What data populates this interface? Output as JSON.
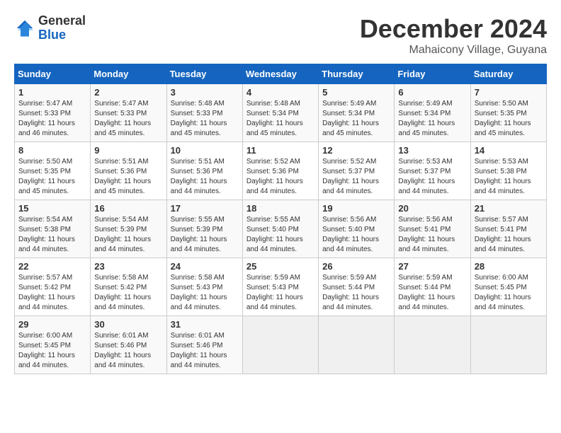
{
  "header": {
    "logo_line1": "General",
    "logo_line2": "Blue",
    "month": "December 2024",
    "location": "Mahaicony Village, Guyana"
  },
  "weekdays": [
    "Sunday",
    "Monday",
    "Tuesday",
    "Wednesday",
    "Thursday",
    "Friday",
    "Saturday"
  ],
  "weeks": [
    [
      {
        "day": "1",
        "sunrise": "5:47 AM",
        "sunset": "5:33 PM",
        "daylight": "11 hours and 46 minutes."
      },
      {
        "day": "2",
        "sunrise": "5:47 AM",
        "sunset": "5:33 PM",
        "daylight": "11 hours and 45 minutes."
      },
      {
        "day": "3",
        "sunrise": "5:48 AM",
        "sunset": "5:33 PM",
        "daylight": "11 hours and 45 minutes."
      },
      {
        "day": "4",
        "sunrise": "5:48 AM",
        "sunset": "5:34 PM",
        "daylight": "11 hours and 45 minutes."
      },
      {
        "day": "5",
        "sunrise": "5:49 AM",
        "sunset": "5:34 PM",
        "daylight": "11 hours and 45 minutes."
      },
      {
        "day": "6",
        "sunrise": "5:49 AM",
        "sunset": "5:34 PM",
        "daylight": "11 hours and 45 minutes."
      },
      {
        "day": "7",
        "sunrise": "5:50 AM",
        "sunset": "5:35 PM",
        "daylight": "11 hours and 45 minutes."
      }
    ],
    [
      {
        "day": "8",
        "sunrise": "5:50 AM",
        "sunset": "5:35 PM",
        "daylight": "11 hours and 45 minutes."
      },
      {
        "day": "9",
        "sunrise": "5:51 AM",
        "sunset": "5:36 PM",
        "daylight": "11 hours and 45 minutes."
      },
      {
        "day": "10",
        "sunrise": "5:51 AM",
        "sunset": "5:36 PM",
        "daylight": "11 hours and 44 minutes."
      },
      {
        "day": "11",
        "sunrise": "5:52 AM",
        "sunset": "5:36 PM",
        "daylight": "11 hours and 44 minutes."
      },
      {
        "day": "12",
        "sunrise": "5:52 AM",
        "sunset": "5:37 PM",
        "daylight": "11 hours and 44 minutes."
      },
      {
        "day": "13",
        "sunrise": "5:53 AM",
        "sunset": "5:37 PM",
        "daylight": "11 hours and 44 minutes."
      },
      {
        "day": "14",
        "sunrise": "5:53 AM",
        "sunset": "5:38 PM",
        "daylight": "11 hours and 44 minutes."
      }
    ],
    [
      {
        "day": "15",
        "sunrise": "5:54 AM",
        "sunset": "5:38 PM",
        "daylight": "11 hours and 44 minutes."
      },
      {
        "day": "16",
        "sunrise": "5:54 AM",
        "sunset": "5:39 PM",
        "daylight": "11 hours and 44 minutes."
      },
      {
        "day": "17",
        "sunrise": "5:55 AM",
        "sunset": "5:39 PM",
        "daylight": "11 hours and 44 minutes."
      },
      {
        "day": "18",
        "sunrise": "5:55 AM",
        "sunset": "5:40 PM",
        "daylight": "11 hours and 44 minutes."
      },
      {
        "day": "19",
        "sunrise": "5:56 AM",
        "sunset": "5:40 PM",
        "daylight": "11 hours and 44 minutes."
      },
      {
        "day": "20",
        "sunrise": "5:56 AM",
        "sunset": "5:41 PM",
        "daylight": "11 hours and 44 minutes."
      },
      {
        "day": "21",
        "sunrise": "5:57 AM",
        "sunset": "5:41 PM",
        "daylight": "11 hours and 44 minutes."
      }
    ],
    [
      {
        "day": "22",
        "sunrise": "5:57 AM",
        "sunset": "5:42 PM",
        "daylight": "11 hours and 44 minutes."
      },
      {
        "day": "23",
        "sunrise": "5:58 AM",
        "sunset": "5:42 PM",
        "daylight": "11 hours and 44 minutes."
      },
      {
        "day": "24",
        "sunrise": "5:58 AM",
        "sunset": "5:43 PM",
        "daylight": "11 hours and 44 minutes."
      },
      {
        "day": "25",
        "sunrise": "5:59 AM",
        "sunset": "5:43 PM",
        "daylight": "11 hours and 44 minutes."
      },
      {
        "day": "26",
        "sunrise": "5:59 AM",
        "sunset": "5:44 PM",
        "daylight": "11 hours and 44 minutes."
      },
      {
        "day": "27",
        "sunrise": "5:59 AM",
        "sunset": "5:44 PM",
        "daylight": "11 hours and 44 minutes."
      },
      {
        "day": "28",
        "sunrise": "6:00 AM",
        "sunset": "5:45 PM",
        "daylight": "11 hours and 44 minutes."
      }
    ],
    [
      {
        "day": "29",
        "sunrise": "6:00 AM",
        "sunset": "5:45 PM",
        "daylight": "11 hours and 44 minutes."
      },
      {
        "day": "30",
        "sunrise": "6:01 AM",
        "sunset": "5:46 PM",
        "daylight": "11 hours and 44 minutes."
      },
      {
        "day": "31",
        "sunrise": "6:01 AM",
        "sunset": "5:46 PM",
        "daylight": "11 hours and 44 minutes."
      },
      null,
      null,
      null,
      null
    ]
  ]
}
